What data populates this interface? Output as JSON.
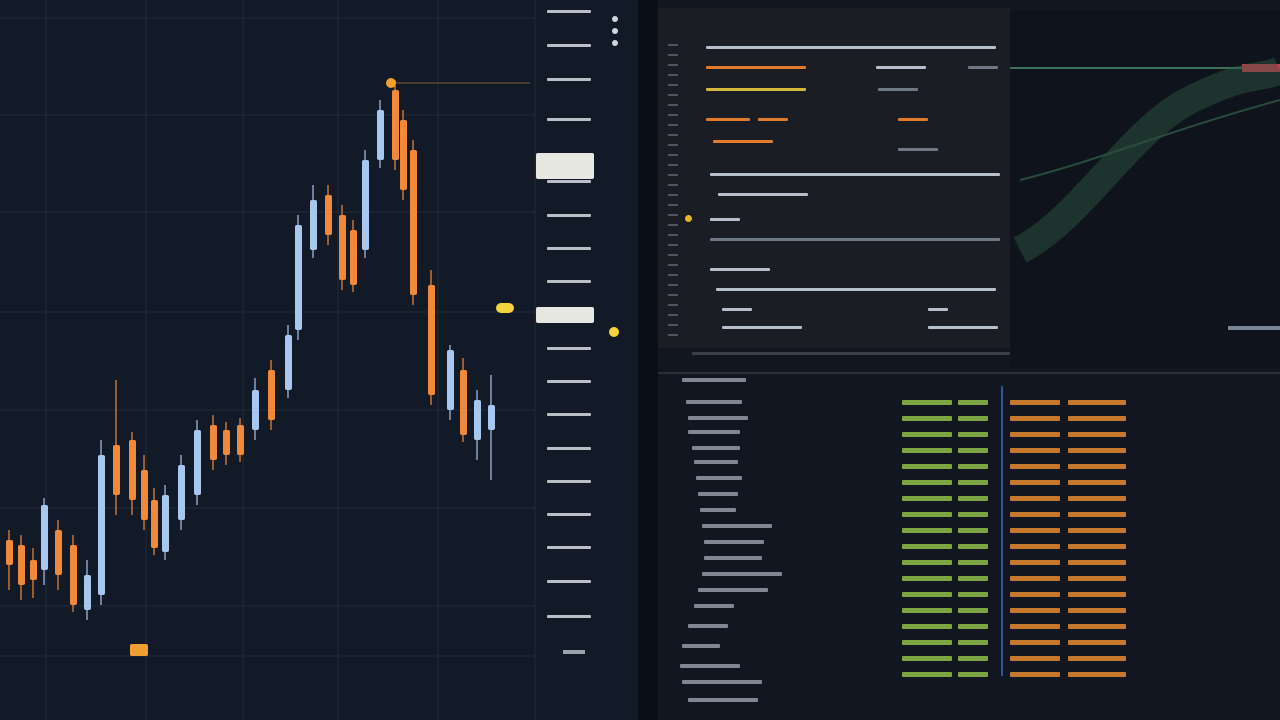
{
  "chart": {
    "colors": {
      "background": "#131a27",
      "grid": "#222b3a",
      "up": "#a9c6ee",
      "down": "#f08a3a",
      "price_tag": "#e7e8e2",
      "marker": "#f4c82a"
    },
    "candles": [
      {
        "o": 1,
        "h": 1,
        "l": 1,
        "c": 1
      }
    ]
  },
  "editor": {
    "title": "",
    "colors": {
      "background": "#1a1d23",
      "accent": "#e0a346",
      "yellow": "#d4b83a",
      "orange": "#e07a2c",
      "comment": "#6f7685",
      "text": "#b8bfcc",
      "green": "#8fbf45"
    }
  },
  "panel": {
    "colors": {
      "green": "#8fbf45",
      "orange": "#e58a2e",
      "blue": "#5a8ad6",
      "teal": "#3d6f5a"
    }
  }
}
